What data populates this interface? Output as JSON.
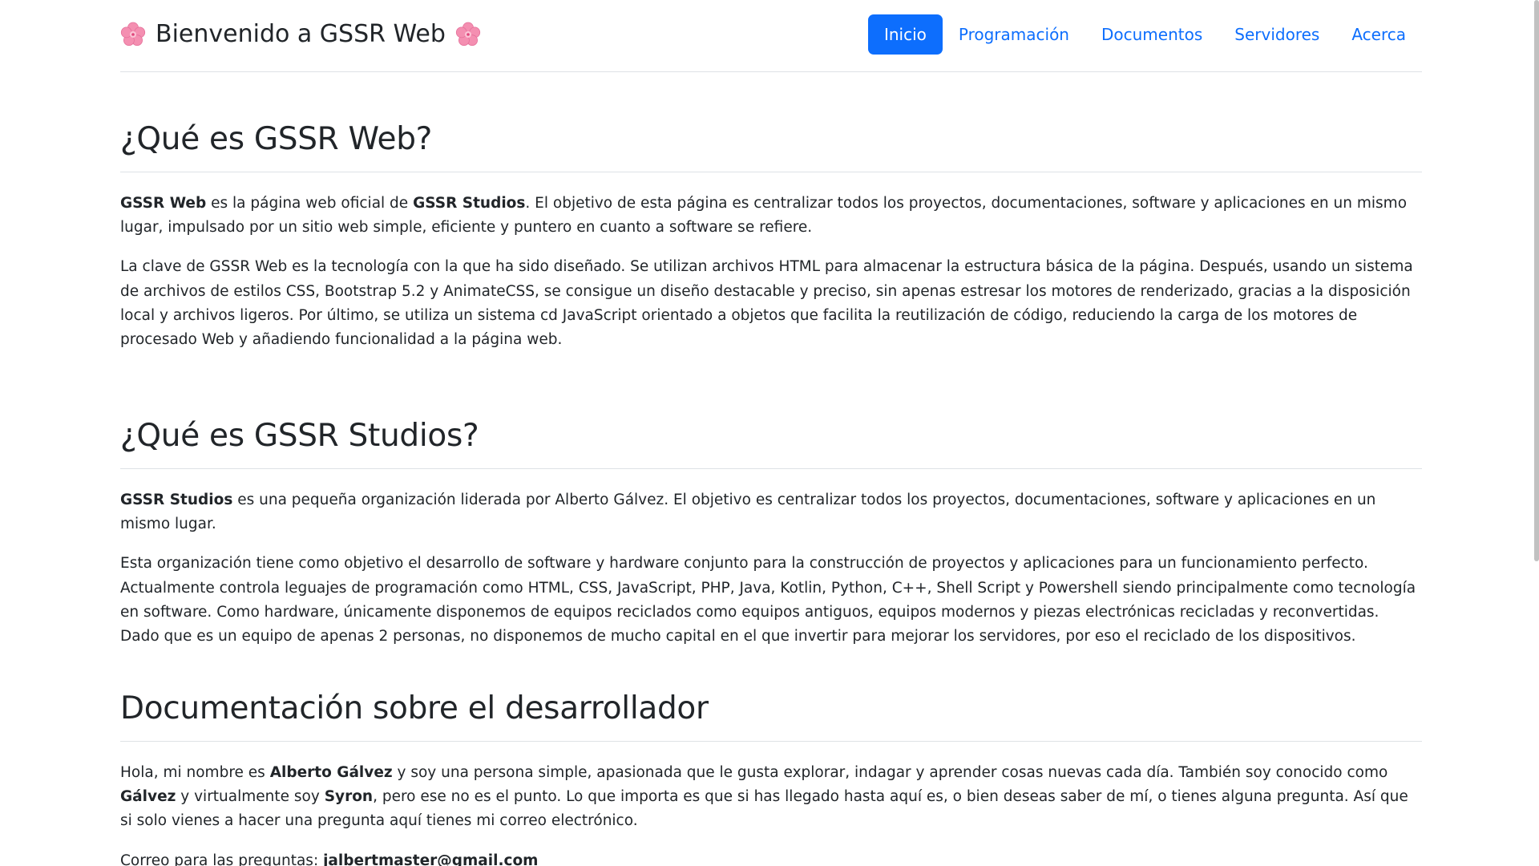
{
  "brand": {
    "title": "Bienvenido a GSSR Web"
  },
  "nav": {
    "items": [
      {
        "label": "Inicio",
        "active": true
      },
      {
        "label": "Programación",
        "active": false
      },
      {
        "label": "Documentos",
        "active": false
      },
      {
        "label": "Servidores",
        "active": false
      },
      {
        "label": "Acerca",
        "active": false
      }
    ]
  },
  "sections": {
    "what_is_web": {
      "heading": "¿Qué es GSSR Web?",
      "p1_b1": "GSSR Web",
      "p1_t1": " es la página web oficial de ",
      "p1_b2": "GSSR Studios",
      "p1_t2": ". El objetivo de esta página es centralizar todos los proyectos, documentaciones, software y aplicaciones en un mismo lugar, impulsado por un sitio web simple, eficiente y puntero en cuanto a software se refiere.",
      "p2": "La clave de GSSR Web es la tecnología con la que ha sido diseñado. Se utilizan archivos HTML para almacenar la estructura básica de la página. Después, usando un sistema de archivos de estilos CSS, Bootstrap 5.2 y AnimateCSS, se consigue un diseño destacable y preciso, sin apenas estresar los motores de renderizado, gracias a la disposición local y archivos ligeros. Por último, se utiliza un sistema cd JavaScript orientado a objetos que facilita la reutilización de código, reduciendo la carga de los motores de procesado Web y añadiendo funcionalidad a la página web."
    },
    "what_is_studios": {
      "heading": "¿Qué es GSSR Studios?",
      "p1_b1": "GSSR Studios",
      "p1_t1": " es una pequeña organización liderada por Alberto Gálvez. El objetivo es centralizar todos los proyectos, documentaciones, software y aplicaciones en un mismo lugar.",
      "p2": "Esta organización tiene como objetivo el desarrollo de software y hardware conjunto para la construcción de proyectos y aplicaciones para un funcionamiento perfecto. Actualmente controla leguajes de programación como HTML, CSS, JavaScript, PHP, Java, Kotlin, Python, C++, Shell Script y Powershell siendo principalmente como tecnología en software. Como hardware, únicamente disponemos de equipos reciclados como equipos antiguos, equipos modernos y piezas electrónicas recicladas y reconvertidas. Dado que es un equipo de apenas 2 personas, no disponemos de mucho capital en el que invertir para mejorar los servidores, por eso el reciclado de los dispositivos."
    },
    "developer": {
      "heading": "Documentación sobre el desarrollador",
      "p1_t1": "Hola, mi nombre es ",
      "p1_b1": "Alberto Gálvez",
      "p1_t2": " y soy una persona simple, apasionada que le gusta explorar, indagar y aprender cosas nuevas cada día. También soy conocido como ",
      "p1_b2": "Gálvez",
      "p1_t3": " y virtualmente soy ",
      "p1_b3": "Syron",
      "p1_t4": ", pero ese no es el punto. Lo que importa es que si has llegado hasta aquí es, o bien deseas saber de mí, o tienes alguna pregunta. Así que si solo vienes a hacer una pregunta aquí tienes mi correo electrónico.",
      "email_label": "Correo para las preguntas: ",
      "email": "jalbertmaster@gmail.com"
    }
  },
  "colors": {
    "accent": "#0d6efd",
    "text": "#212529",
    "divider": "#dee2e6",
    "flower": "#f48fb1"
  }
}
